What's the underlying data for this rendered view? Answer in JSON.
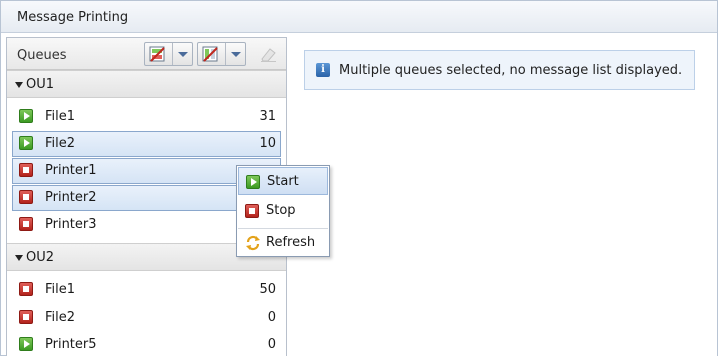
{
  "window": {
    "title": "Message Printing"
  },
  "queues_panel": {
    "title": "Queues",
    "groups": [
      {
        "name": "OU1",
        "items": [
          {
            "label": "File1",
            "count": "31",
            "status": "running",
            "selected": false
          },
          {
            "label": "File2",
            "count": "10",
            "status": "running",
            "selected": true
          },
          {
            "label": "Printer1",
            "count": "",
            "status": "stopped",
            "selected": true
          },
          {
            "label": "Printer2",
            "count": "",
            "status": "stopped",
            "selected": true
          },
          {
            "label": "Printer3",
            "count": "",
            "status": "stopped",
            "selected": false
          }
        ]
      },
      {
        "name": "OU2",
        "items": [
          {
            "label": "File1",
            "count": "50",
            "status": "stopped",
            "selected": false
          },
          {
            "label": "File2",
            "count": "0",
            "status": "stopped",
            "selected": false
          },
          {
            "label": "Printer5",
            "count": "0",
            "status": "running",
            "selected": false
          }
        ]
      }
    ]
  },
  "info_message": "Multiple queues selected, no message list displayed.",
  "context_menu": {
    "items": [
      {
        "label": "Start",
        "icon": "start-icon"
      },
      {
        "label": "Stop",
        "icon": "stop-icon"
      },
      {
        "label": "Refresh",
        "icon": "refresh-icon"
      }
    ]
  },
  "colors": {
    "running": "#3c9a23",
    "stopped": "#b3231c",
    "selection": "#d5e4f5",
    "info": "#2a63a8"
  }
}
